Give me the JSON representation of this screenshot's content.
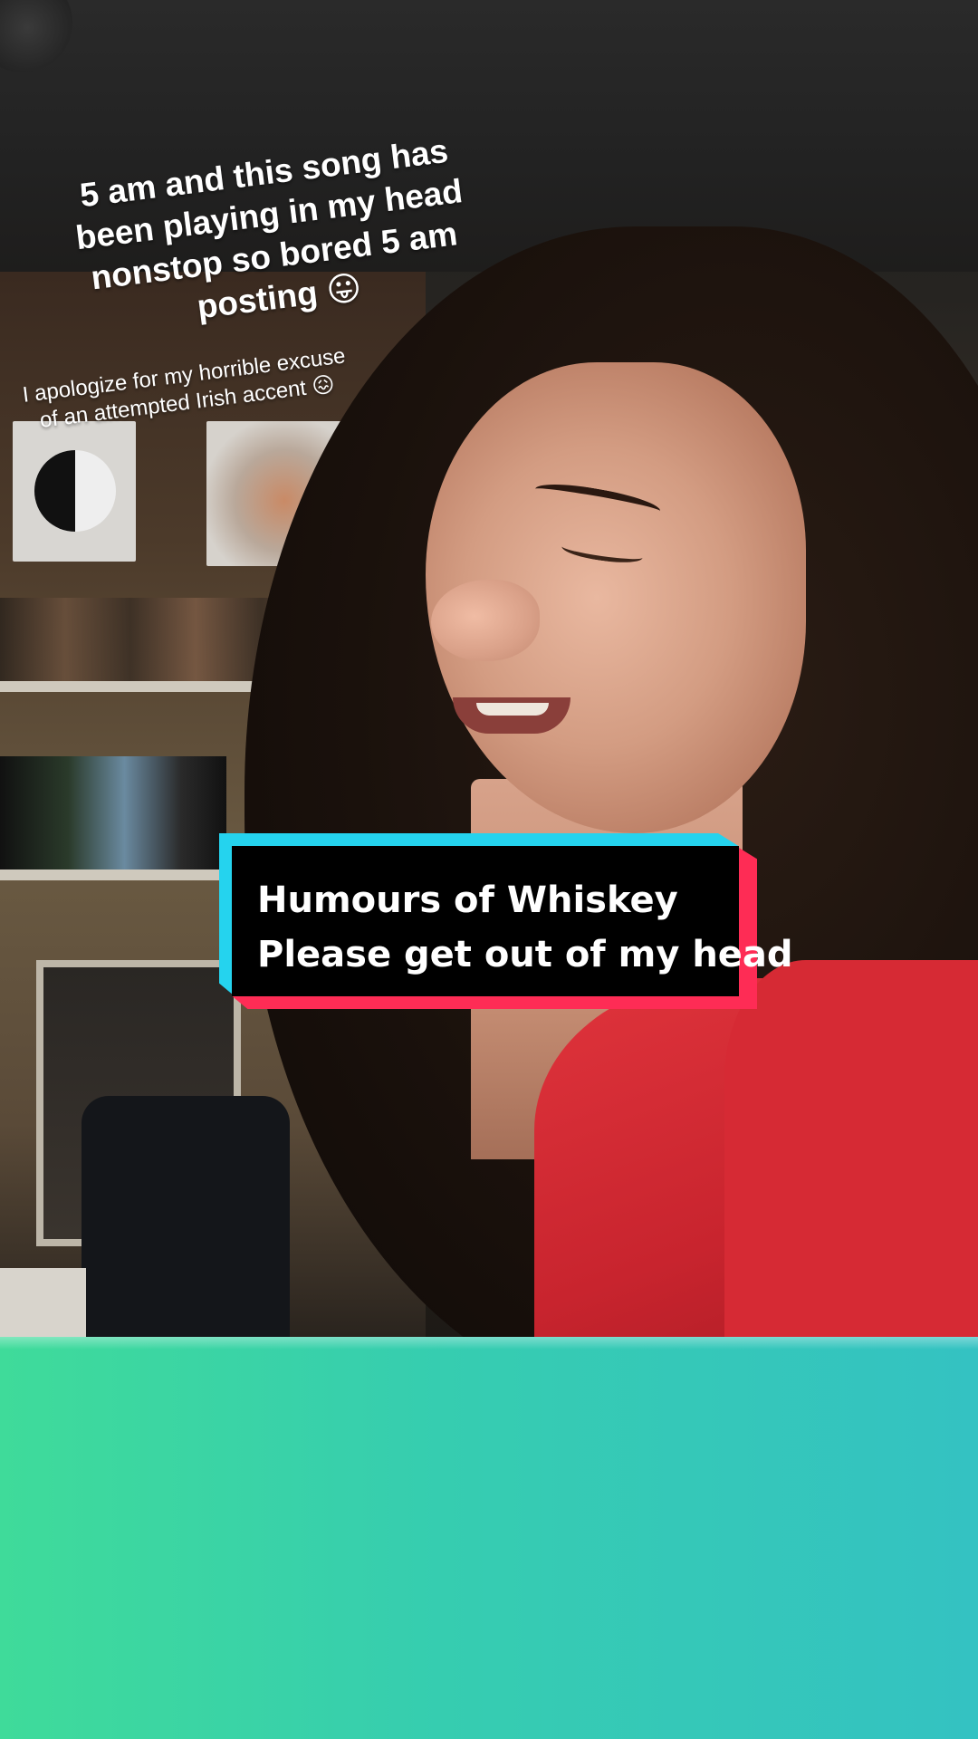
{
  "overlay": {
    "caption_main": "5 am and this song has been playing in my head nonstop so bored 5 am posting 😛",
    "caption_sub": "I apologize for my horrible excuse of an attempted Irish accent 😖",
    "title_card": {
      "line1": "Humours of Whiskey",
      "line2": "Please get out of my head"
    }
  },
  "colors": {
    "bottom_panel_left": "#3fdb9a",
    "bottom_panel_right": "#34c2c2",
    "card_cyan": "#25d3ee",
    "card_red": "#fe2c55",
    "card_bg": "#000000"
  }
}
